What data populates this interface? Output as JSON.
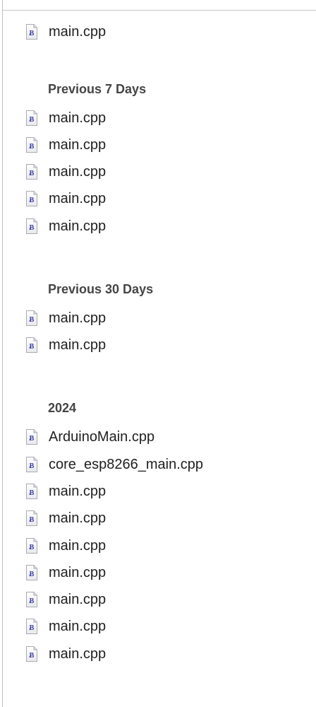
{
  "sections": [
    {
      "title": "",
      "files": [
        "main.cpp"
      ]
    },
    {
      "title": "Previous 7 Days",
      "files": [
        "main.cpp",
        "main.cpp",
        "main.cpp",
        "main.cpp",
        "main.cpp"
      ]
    },
    {
      "title": "Previous 30 Days",
      "files": [
        "main.cpp",
        "main.cpp"
      ]
    },
    {
      "title": "2024",
      "files": [
        "ArduinoMain.cpp",
        "core_esp8266_main.cpp",
        "main.cpp",
        "main.cpp",
        "main.cpp",
        "main.cpp",
        "main.cpp",
        "main.cpp",
        "main.cpp"
      ]
    }
  ],
  "icon": "cpp-source-file-icon",
  "colors": {
    "text": "#1f1f1f",
    "section_title": "#454545",
    "divider": "#c6c6c6"
  }
}
